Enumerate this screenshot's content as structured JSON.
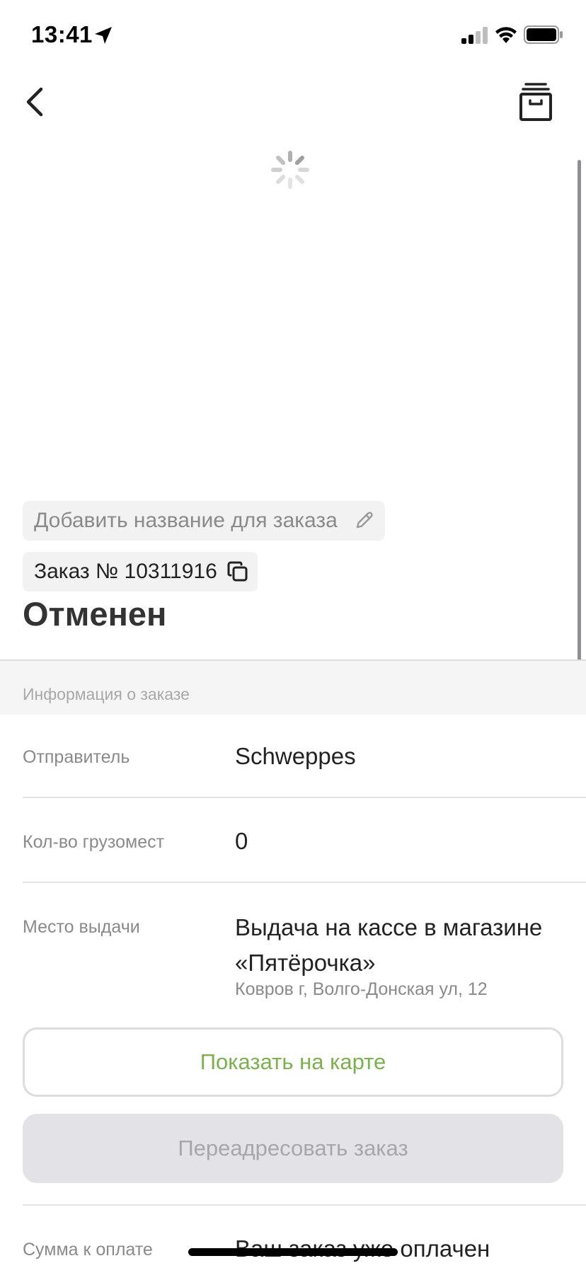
{
  "status_bar": {
    "time": "13:41",
    "icons": [
      "location-arrow-icon",
      "signal-icon",
      "wifi-icon",
      "battery-icon"
    ]
  },
  "nav": {
    "back_icon": "chevron-left-icon",
    "archive_icon": "archive-box-icon"
  },
  "order": {
    "name_placeholder": "Добавить название для заказа",
    "number_label": "Заказ № 10311916",
    "status": "Отменен"
  },
  "info_section": {
    "title": "Информация о заказе",
    "rows": [
      {
        "label": "Отправитель",
        "value": "Schweppes"
      },
      {
        "label": "Кол-во грузомест",
        "value": "0"
      },
      {
        "label": "Место выдачи",
        "value": "Выдача на кассе в магазине «Пятёрочка»",
        "sub": "Ковров г, Волго-Донская ул, 12"
      },
      {
        "label": "Сумма к оплате",
        "value": "Ваш заказ уже оплачен"
      }
    ]
  },
  "buttons": {
    "show_on_map": "Показать на карте",
    "redirect_order": "Переадресовать заказ"
  },
  "colors": {
    "accent_green": "#7cb050",
    "disabled_button_bg": "#e3e3e7",
    "disabled_button_text": "#a6a6ab",
    "chip_bg": "#f2f2f2"
  }
}
